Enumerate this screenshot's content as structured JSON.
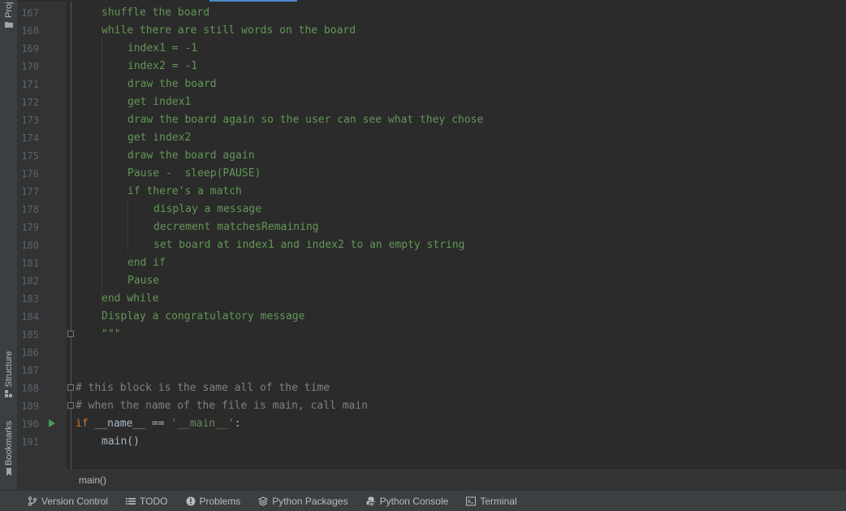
{
  "left_strip": {
    "project_label": "Proj",
    "structure_label": "Structure",
    "bookmarks_label": "Bookmarks"
  },
  "editor": {
    "lines": [
      {
        "num": "167",
        "text": "shuffle the board"
      },
      {
        "num": "168",
        "text": "while there are still words on the board"
      },
      {
        "num": "169",
        "text": "index1 = -1"
      },
      {
        "num": "170",
        "text": "index2 = -1"
      },
      {
        "num": "171",
        "text": "draw the board"
      },
      {
        "num": "172",
        "text": "get index1"
      },
      {
        "num": "173",
        "text": "draw the board again so the user can see what they chose"
      },
      {
        "num": "174",
        "text": "get index2"
      },
      {
        "num": "175",
        "text": "draw the board again"
      },
      {
        "num": "176",
        "text": "Pause -  sleep(PAUSE)"
      },
      {
        "num": "177",
        "text": "if there's a match"
      },
      {
        "num": "178",
        "text": "display a message"
      },
      {
        "num": "179",
        "text": "decrement matchesRemaining"
      },
      {
        "num": "180",
        "text": "set board at index1 and index2 to an empty string"
      },
      {
        "num": "181",
        "text": "end if"
      },
      {
        "num": "182",
        "text": "Pause"
      },
      {
        "num": "183",
        "text": "end while"
      },
      {
        "num": "184",
        "text": "Display a congratulatory message"
      },
      {
        "num": "185",
        "text": "\"\"\""
      },
      {
        "num": "186",
        "text": ""
      },
      {
        "num": "187",
        "text": ""
      },
      {
        "num": "188",
        "text": "# this block is the same all of the time"
      },
      {
        "num": "189",
        "text": "# when the name of the file is main, call main"
      },
      {
        "num": "190",
        "kw": "if",
        "mid": " __name__ == ",
        "str": "'__main__'",
        "end": ":"
      },
      {
        "num": "191",
        "text": "main()"
      }
    ]
  },
  "breadcrumb": {
    "text": "main()"
  },
  "bottom_bar": {
    "tabs": [
      {
        "label": "Version Control"
      },
      {
        "label": "TODO"
      },
      {
        "label": "Problems"
      },
      {
        "label": "Python Packages"
      },
      {
        "label": "Python Console"
      },
      {
        "label": "Terminal"
      }
    ]
  },
  "colors": {
    "docstring": "#629755",
    "comment": "#808080",
    "keyword": "#cc7832",
    "string": "#6a8759",
    "run_icon": "#499c54"
  }
}
